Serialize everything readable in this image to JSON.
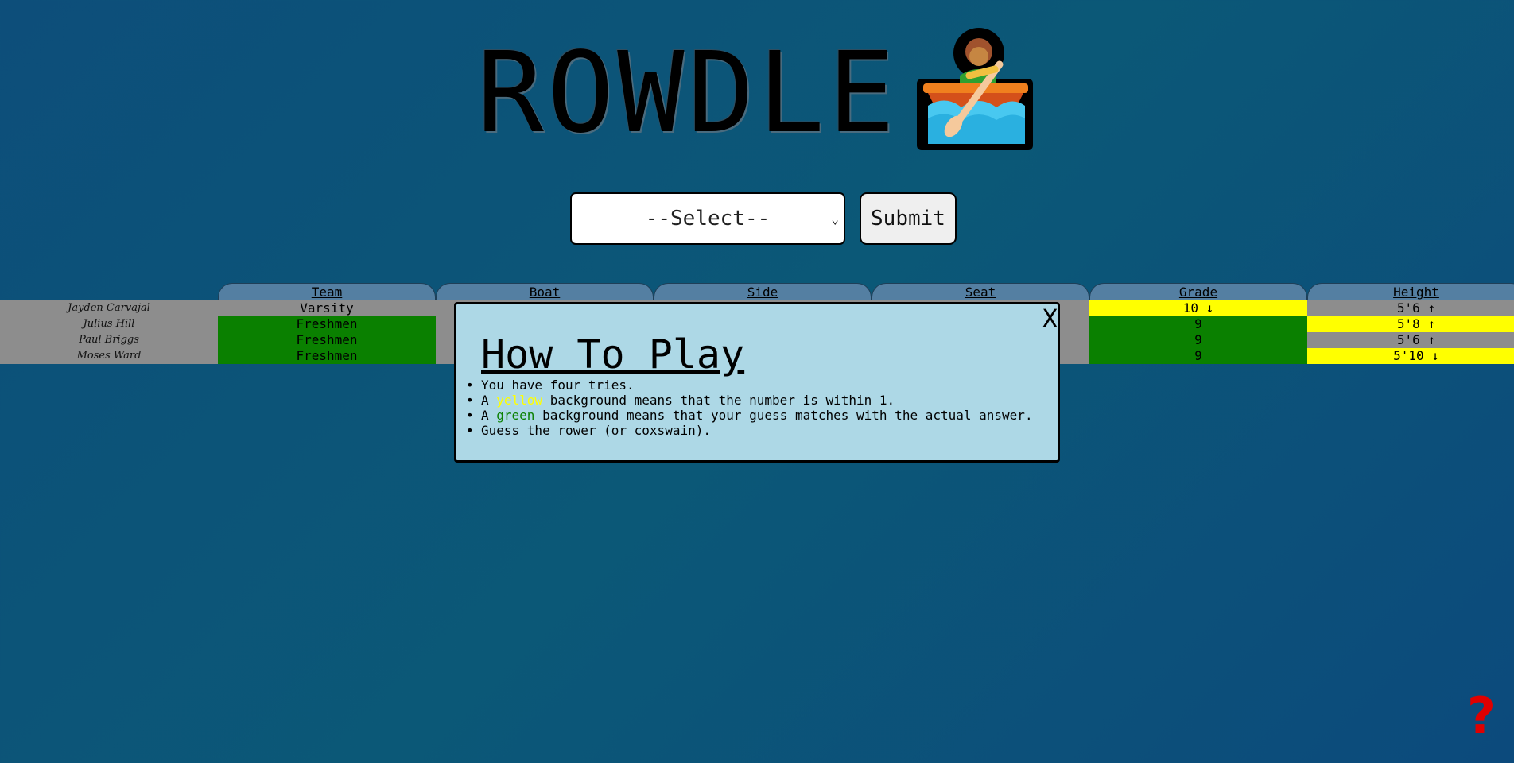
{
  "header": {
    "title": "ROWDLE",
    "icon": "person-rowing-boat-icon"
  },
  "controls": {
    "select_value": "--Select--",
    "submit_label": "Submit"
  },
  "table": {
    "columns": [
      "Team",
      "Boat",
      "Side",
      "Seat",
      "Grade",
      "Height"
    ],
    "rows": [
      {
        "name": "Jayden Carvajal",
        "team": "Varsity",
        "grade": "10 ↓",
        "height": "5'6 ↑",
        "colors": {
          "team": "gray",
          "grade": "yellow",
          "height": "gray"
        }
      },
      {
        "name": "Julius Hill",
        "team": "Freshmen",
        "grade": "9",
        "height": "5'8 ↑",
        "colors": {
          "team": "green",
          "grade": "green",
          "height": "yellow"
        }
      },
      {
        "name": "Paul Briggs",
        "team": "Freshmen",
        "grade": "9",
        "height": "5'6 ↑",
        "colors": {
          "team": "green",
          "grade": "green",
          "height": "gray"
        }
      },
      {
        "name": "Moses Ward",
        "team": "Freshmen",
        "grade": "9",
        "height": "5'10 ↓",
        "colors": {
          "team": "green",
          "grade": "green",
          "height": "yellow"
        }
      }
    ]
  },
  "modal": {
    "close_label": "X",
    "title": "How To Play",
    "bullet": "•",
    "line1": "You have four tries.",
    "line2_pre": "A ",
    "line2_word": "yellow",
    "line2_post": " background means that the number is within 1.",
    "line3_pre": "A ",
    "line3_word": "green",
    "line3_post": " background means that your guess matches with the actual answer.",
    "line4": "Guess the rower (or coxswain)."
  },
  "help": {
    "label": "?",
    "color": "#e00000"
  },
  "colors": {
    "gray": "#8d8d8d",
    "green": "#0a8000",
    "yellow": "#ffff00",
    "modal_bg": "#add8e6",
    "header_tab": "#547fa2"
  }
}
